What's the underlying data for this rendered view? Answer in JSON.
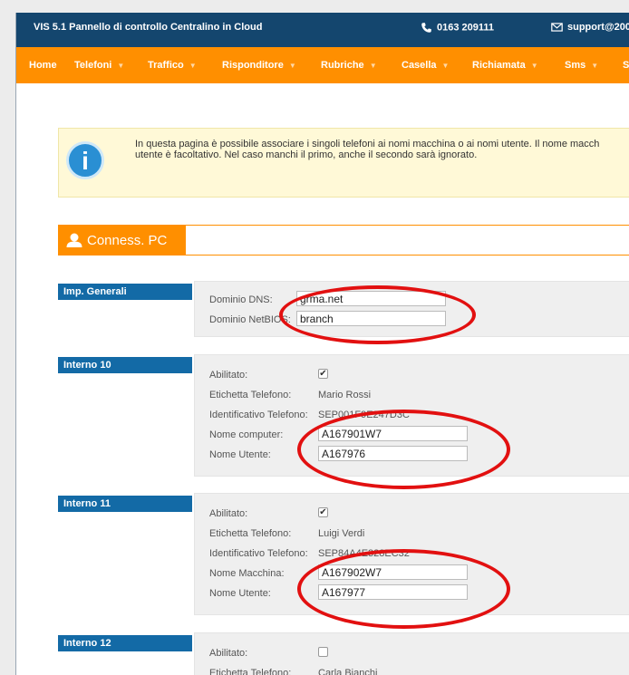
{
  "topbar": {
    "title": "VIS 5.1 Pannello di controllo Centralino in Cloud",
    "phone": "0163 209111",
    "email": "support@200"
  },
  "nav": {
    "items": [
      "Home",
      "Telefoni",
      "Traffico",
      "Risponditore",
      "Rubriche",
      "Casella",
      "Richiamata",
      "Sms",
      "S"
    ]
  },
  "info": {
    "text": "In questa pagina è possibile associare i singoli telefoni ai nomi macchina o ai nomi utente. Il nome macch\nutente è facoltativo. Nel caso manchi il primo, anche il secondo sarà ignorato."
  },
  "section": {
    "title": "Conness. PC"
  },
  "general": {
    "label": "Imp. Generali",
    "dns_label": "Dominio DNS:",
    "dns_value": "grma.net",
    "netbios_label": "Dominio NetBIOS:",
    "netbios_value": "branch"
  },
  "interni": [
    {
      "label": "Interno 10",
      "enabled_label": "Abilitato:",
      "enabled": true,
      "tag_label": "Etichetta Telefono:",
      "tag_value": "Mario Rossi",
      "id_label": "Identificativo Telefono:",
      "id_value": "SEP001F9E247D3C",
      "computer_label": "Nome computer:",
      "computer_value": "A167901W7",
      "user_label": "Nome Utente:",
      "user_value": "A167976"
    },
    {
      "label": "Interno 11",
      "enabled_label": "Abilitato:",
      "enabled": true,
      "tag_label": "Etichetta Telefono:",
      "tag_value": "Luigi Verdi",
      "id_label": "Identificativo Telefono:",
      "id_value": "SEP84A4E328EC32",
      "computer_label": "Nome Macchina:",
      "computer_value": "A167902W7",
      "user_label": "Nome Utente:",
      "user_value": "A167977"
    },
    {
      "label": "Interno 12",
      "enabled_label": "Abilitato:",
      "enabled": false,
      "tag_label": "Etichetta Telefono:",
      "tag_value": "Carla Bianchi"
    }
  ],
  "colors": {
    "topbar": "#14466e",
    "navbar": "#ff8f00",
    "label_blue": "#136aa6",
    "annotation_red": "#e21010"
  },
  "icons": {
    "phone": "phone-icon",
    "mail": "mail-icon",
    "info": "info-icon",
    "person": "person-icon",
    "caret": "caret-down-icon"
  }
}
